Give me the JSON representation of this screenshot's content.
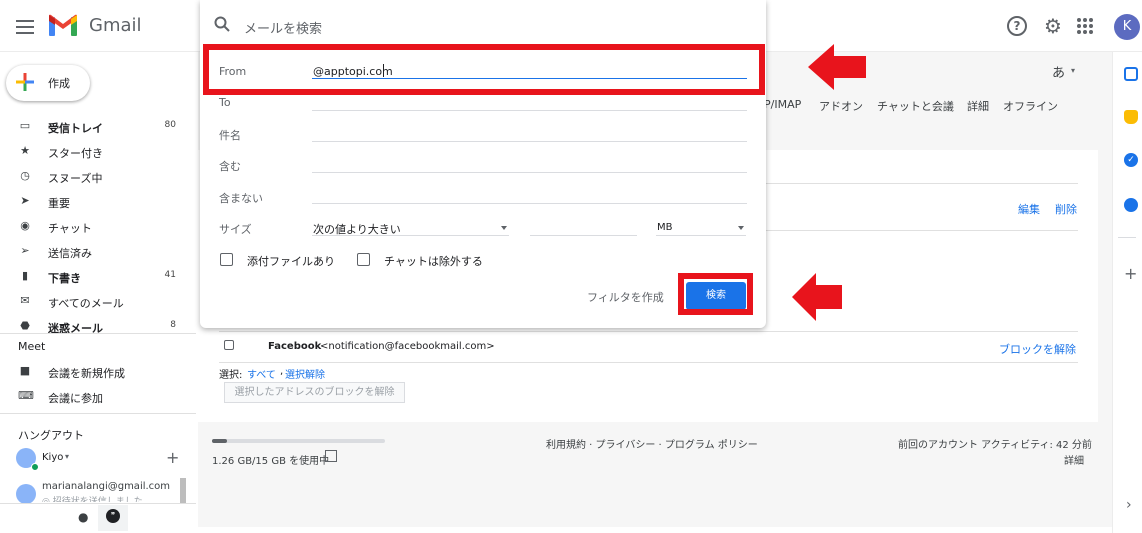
{
  "app": {
    "name": "Gmail"
  },
  "header": {
    "search_placeholder": "メールを検索",
    "avatar_letter": "K",
    "help_glyph": "?"
  },
  "sidebar": {
    "compose_label": "作成",
    "items": [
      {
        "label": "受信トレイ",
        "count": "80",
        "bold": true,
        "icon": "inbox-icon"
      },
      {
        "label": "スター付き",
        "count": "",
        "bold": false,
        "icon": "star-icon"
      },
      {
        "label": "スヌーズ中",
        "count": "",
        "bold": false,
        "icon": "clock-icon"
      },
      {
        "label": "重要",
        "count": "",
        "bold": false,
        "icon": "important-icon"
      },
      {
        "label": "チャット",
        "count": "",
        "bold": false,
        "icon": "chat-icon"
      },
      {
        "label": "送信済み",
        "count": "",
        "bold": false,
        "icon": "send-icon"
      },
      {
        "label": "下書き",
        "count": "41",
        "bold": true,
        "icon": "draft-icon"
      },
      {
        "label": "すべてのメール",
        "count": "",
        "bold": false,
        "icon": "mail-icon"
      },
      {
        "label": "迷惑メール",
        "count": "8",
        "bold": true,
        "icon": "spam-icon"
      }
    ],
    "meet_title": "Meet",
    "meet_items": [
      {
        "label": "会議を新規作成",
        "icon": "video-icon"
      },
      {
        "label": "会議に参加",
        "icon": "keyboard-icon"
      }
    ],
    "hangouts_title": "ハングアウト",
    "hangouts_user": "Kiyo",
    "hangouts_contact_email": "marianalangi@gmail.com",
    "hangouts_contact_status": "◎ 招待状を送信しました"
  },
  "settings": {
    "lang_glyph": "あ",
    "tabs": [
      "P/IMAP",
      "アドオン",
      "チャットと会議",
      "詳細",
      "オフライン"
    ],
    "edit_link": "編集",
    "delete_link": "削除",
    "blocked_sender_name": "Facebook",
    "blocked_sender_email": "<notification@facebookmail.com>",
    "unblock_link": "ブロックを解除",
    "select_label": "選択:",
    "select_all": "すべて",
    "select_none": "選択解除",
    "unblock_selected_button": "選択したアドレスのブロックを解除"
  },
  "footer": {
    "storage": "1.26 GB/15 GB を使用中",
    "storage_fraction": 0.084,
    "terms": "利用規約 · プライバシー · プログラム ポリシー",
    "activity": "前回のアカウント アクティビティ: 42 分前",
    "details": "詳細"
  },
  "search_popup": {
    "fields": [
      {
        "label": "From",
        "value": "@apptopi.com"
      },
      {
        "label": "To",
        "value": ""
      },
      {
        "label": "件名",
        "value": ""
      },
      {
        "label": "含む",
        "value": ""
      },
      {
        "label": "含まない",
        "value": ""
      }
    ],
    "size_label": "サイズ",
    "size_operator": "次の値より大きい",
    "size_value": "",
    "size_unit": "MB",
    "has_attachment": "添付ファイルあり",
    "exclude_chats": "チャットは除外する",
    "create_filter": "フィルタを作成",
    "search_button": "検索"
  },
  "colors": {
    "annotation_red": "#e8141c",
    "accent_blue": "#1a73e8"
  }
}
